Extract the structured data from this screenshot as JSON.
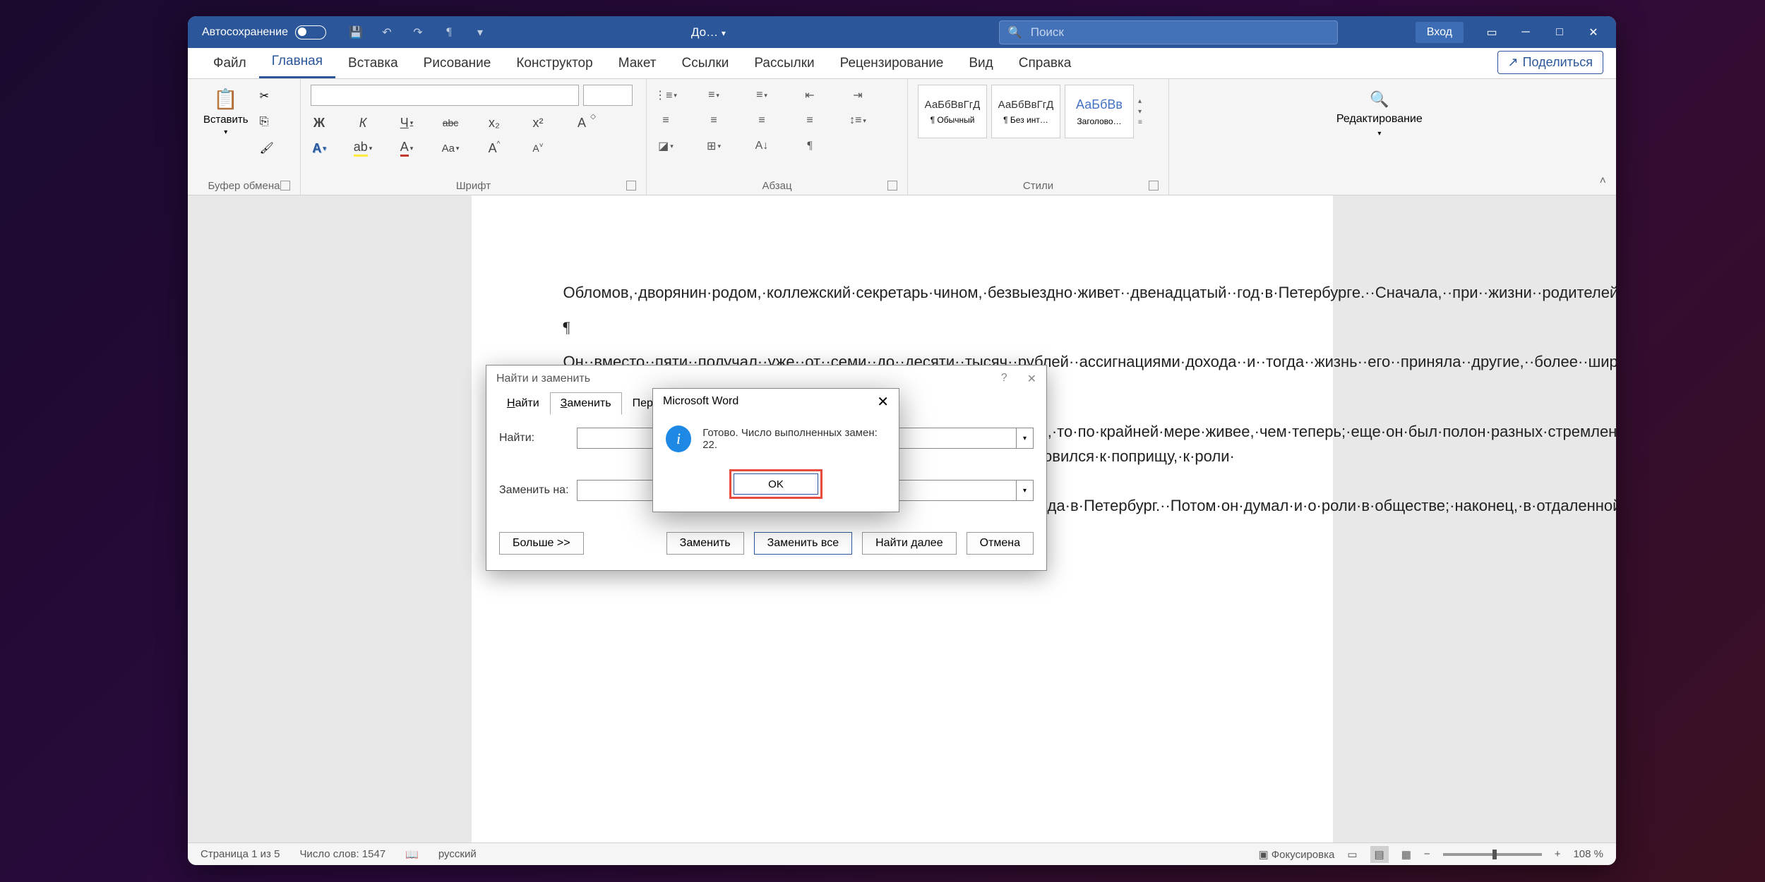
{
  "titlebar": {
    "autosave": "Автосохранение",
    "title": "До…",
    "search_placeholder": "Поиск",
    "login": "Вход"
  },
  "tabs": {
    "file": "Файл",
    "home": "Главная",
    "insert": "Вставка",
    "draw": "Рисование",
    "design": "Конструктор",
    "layout": "Макет",
    "references": "Ссылки",
    "mailings": "Рассылки",
    "review": "Рецензирование",
    "view": "Вид",
    "help": "Справка",
    "share": "Поделиться"
  },
  "ribbon": {
    "clipboard": {
      "paste": "Вставить",
      "label": "Буфер обмена"
    },
    "font": {
      "label": "Шрифт",
      "bold": "Ж",
      "italic": "К",
      "underline": "Ч",
      "strike": "abc",
      "sub": "x₂",
      "sup": "x²",
      "clear": "A",
      "fontcolor": "A",
      "highlight": "A",
      "case": "Aa",
      "grow": "A^",
      "shrink": "A˅"
    },
    "paragraph": {
      "label": "Абзац"
    },
    "styles": {
      "label": "Стили",
      "s1_preview": "АаБбВвГгД",
      "s1_name": "¶ Обычный",
      "s2_preview": "АаБбВвГгД",
      "s2_name": "¶ Без инт…",
      "s3_preview": "АаБбВв",
      "s3_name": "Заголово…"
    },
    "editing": {
      "label": "Редактирование"
    }
  },
  "document": {
    "p1": "Обломов,·дворянин·родом,·коллежский·секретарь·чином,·безвыездно·живет··двенадцатый··год·в·Петербурге.··Сначала,··при··жизни··родителей,··жил··потеснее,··помещался··в··двух··комнатах,·довольствовался·только·вывезенным·им·из·деревни·слугой·Захаром;·но·по·смерти·отца·и·матери·он·стал·единственным·обладателем·трехсот·пятидесяти·душ,·доставшихся·ему·в·наследство·в·одном·из·отдаленных·губерний.¶",
    "pilcrow": "¶",
    "p2": "Он··вместо··пяти··получал··уже··от··семи··до··десяти··тысяч··рублей··ассигнациями·дохода··и··тогда··жизнь··его··приняла··другие,··более··широкие··размеры.··Он··нанял··квартиру··побольше,··прибавил··к··своему··штату··еще··повара··и··завел··было··пару·лошадей.¶",
    "p3": "Тогда·еще·он·был·молод,·и·если·нельзя·сказать,·чтоб·он·был·жив,·то·по·крайней·мере·живее,·чем·теперь;·еще·он·был·полон·разных·стремлений,·все·чего-то·надеялся,·ждал·многого·и·от·судьбы,·и·от·самого·себя;·все·готовился·к·поприщу,·к·роли·—·прежде·всего,·разумеется,·в·службе,·что·и·было·целью·его·приезда·в·Петербург.··Потом·он·думал·и·о·роли·в·обществе;·наконец,·в·отдаленной·перспективе,·на·повороте·с·юности·к·зрелым·летам,·воображению·его·мелькало·и·улыбалось·семейное·счастие.¶"
  },
  "find_replace": {
    "title": "Найти и заменить",
    "tab_find": "Найти",
    "tab_replace": "Заменить",
    "tab_goto": "Перейти",
    "find_label": "Найти:",
    "replace_label": "Заменить на:",
    "more": "Больше >>",
    "replace": "Заменить",
    "replace_all": "Заменить все",
    "find_next": "Найти далее",
    "cancel": "Отмена"
  },
  "msgbox": {
    "title": "Microsoft Word",
    "message": "Готово. Число выполненных замен: 22.",
    "ok": "OK"
  },
  "statusbar": {
    "page": "Страница 1 из 5",
    "words": "Число слов: 1547",
    "lang": "русский",
    "focus": "Фокусировка",
    "zoom": "108 %"
  }
}
